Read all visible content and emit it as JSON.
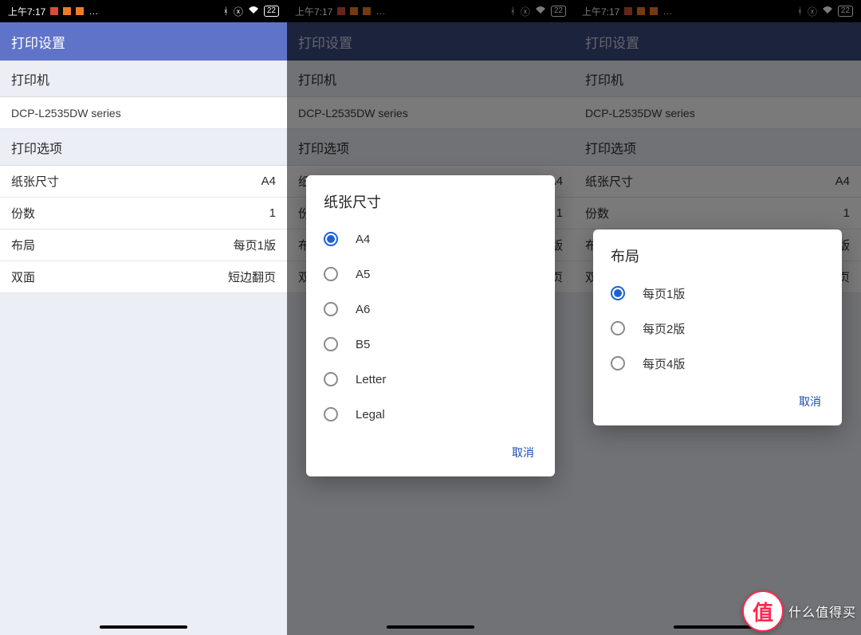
{
  "status": {
    "time": "上午7:17",
    "dots": "…",
    "battery": "22"
  },
  "header": {
    "title": "打印设置"
  },
  "sections": {
    "printer_label": "打印机",
    "printer_name": "DCP-L2535DW series",
    "options_label": "打印选项"
  },
  "rows": {
    "paper_size": {
      "label": "纸张尺寸",
      "value": "A4"
    },
    "copies": {
      "label": "份数",
      "value": "1"
    },
    "layout": {
      "label": "布局",
      "value": "每页1版"
    },
    "duplex": {
      "label": "双面",
      "value": "短边翻页"
    }
  },
  "dialog_paper": {
    "title": "纸张尺寸",
    "options": [
      "A4",
      "A5",
      "A6",
      "B5",
      "Letter",
      "Legal"
    ],
    "selected": 0,
    "cancel": "取消"
  },
  "dialog_layout": {
    "title": "布局",
    "options": [
      "每页1版",
      "每页2版",
      "每页4版"
    ],
    "selected": 0,
    "cancel": "取消"
  },
  "watermark": {
    "badge": "值",
    "text": "什么值得买"
  }
}
